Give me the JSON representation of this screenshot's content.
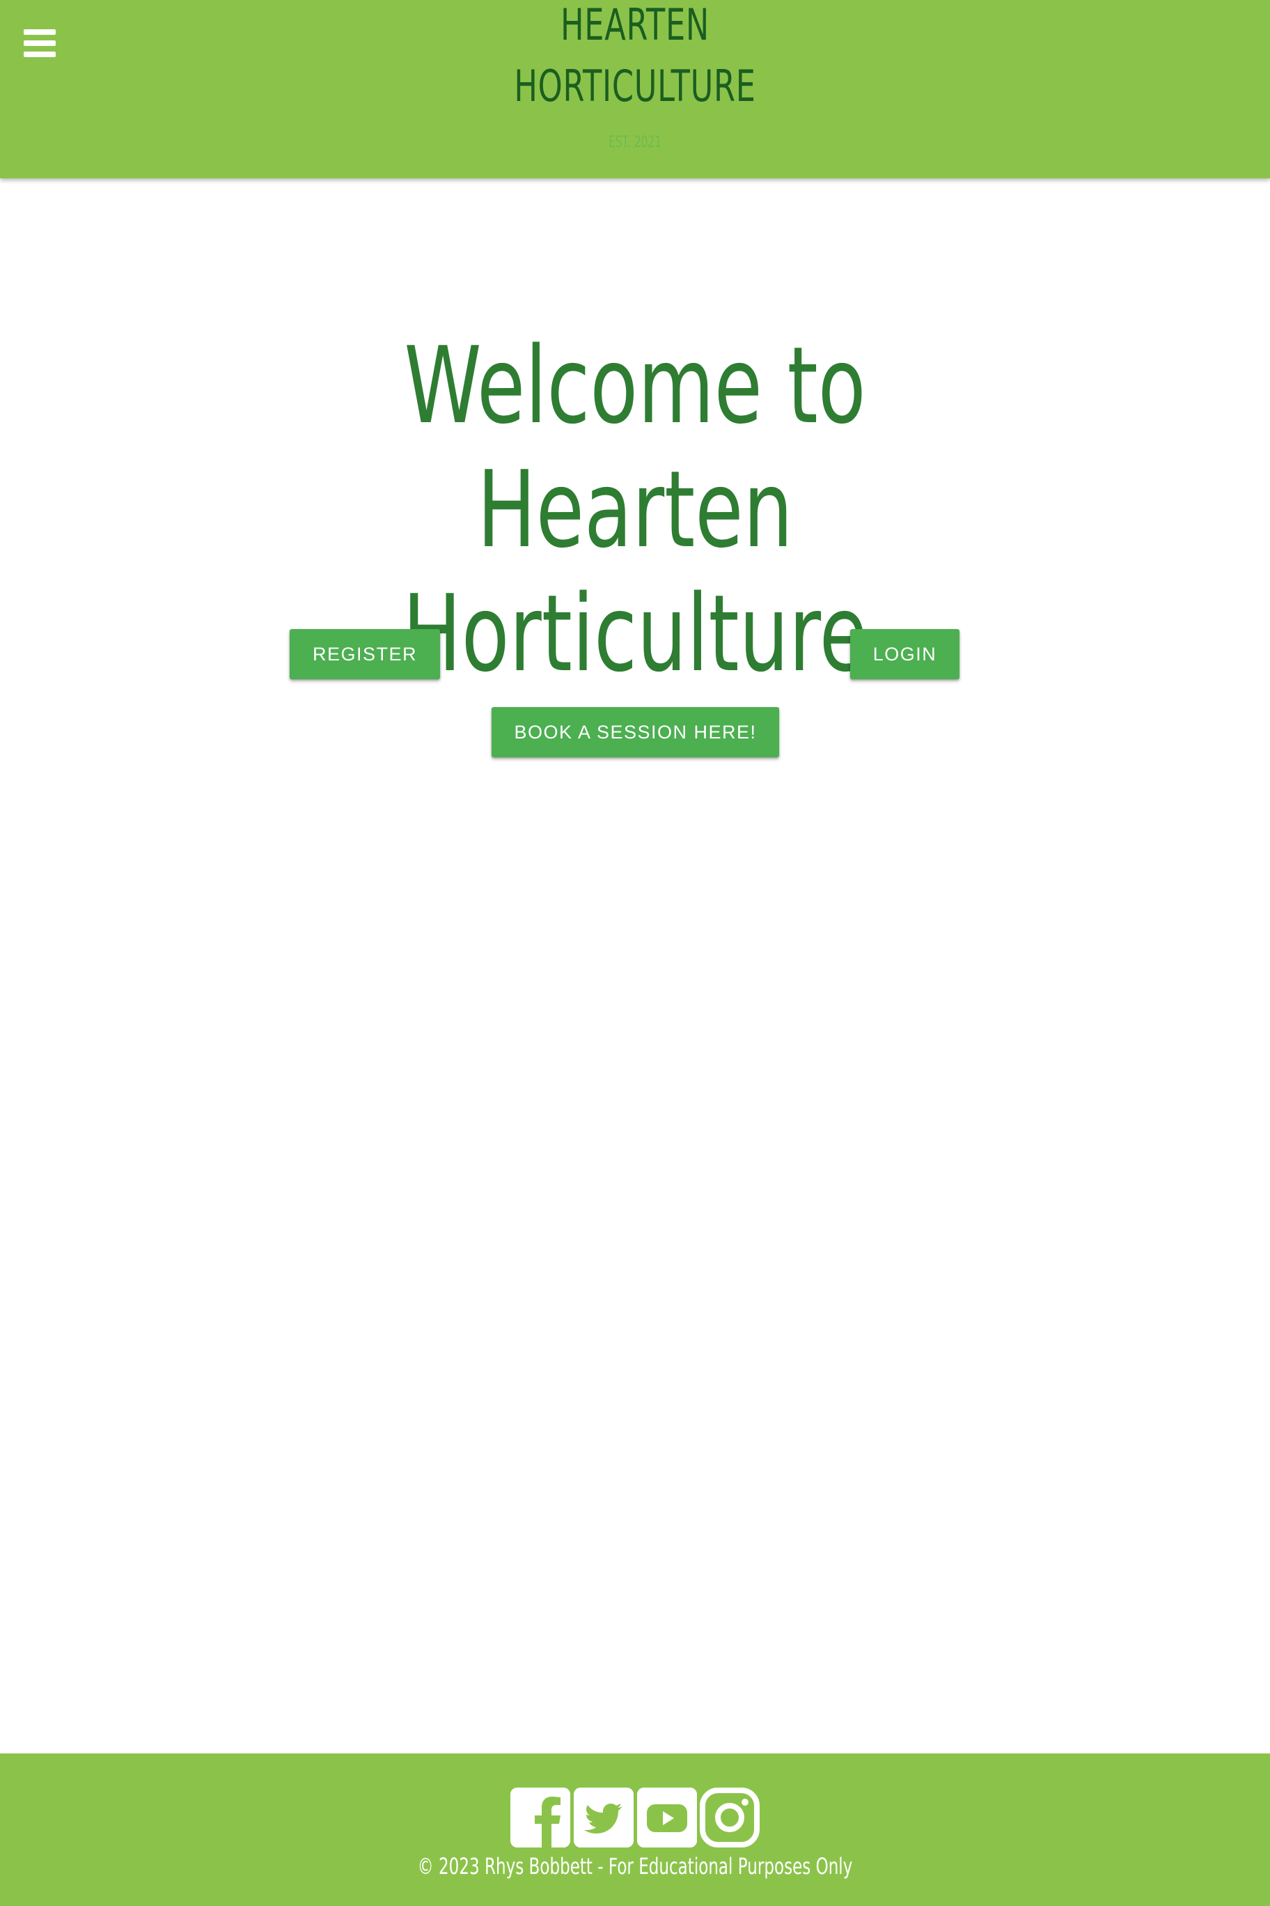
{
  "header": {
    "brand_line1": "HEARTEN",
    "brand_line2": "HORTICULTURE",
    "established": "EST. 2021",
    "menu_icon": "hamburger-menu-icon",
    "background_color": "#8bc34a",
    "brand_color": "#1b5e20"
  },
  "main": {
    "title_line1": "Welcome to Hearten",
    "title_line2": "Horticulture",
    "title_color": "#2e7d32",
    "buttons": {
      "register": "REGISTER",
      "login": "LOGIN",
      "book": "BOOK A SESSION HERE!"
    },
    "button_color": "#4caf50"
  },
  "footer": {
    "social_icons": [
      "facebook-icon",
      "twitter-icon",
      "youtube-icon",
      "instagram-icon"
    ],
    "copyright": "© 2023 Rhys Bobbett - For Educational Purposes Only",
    "background_color": "#8bc34a"
  }
}
